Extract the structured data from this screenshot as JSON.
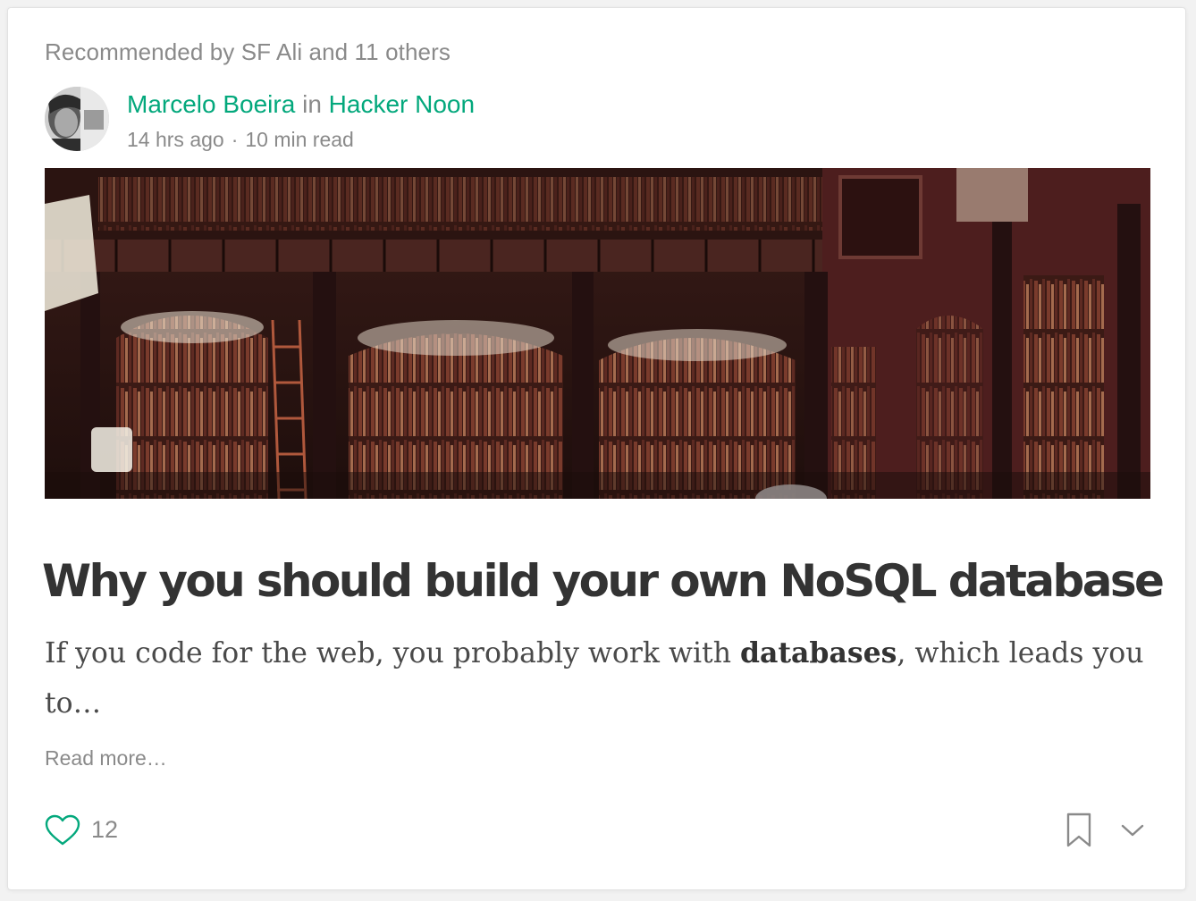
{
  "recommendation": "Recommended by SF Ali and 11 others",
  "author": {
    "name": "Marcelo Boeira",
    "in_word": "in",
    "publication": "Hacker Noon"
  },
  "meta": {
    "time_ago": "14 hrs ago",
    "separator": "·",
    "read_time": "10 min read"
  },
  "hero_image": {
    "subject": "library-interior",
    "palette": [
      "#2a1512",
      "#5a2a24",
      "#8c5a44",
      "#e8dcc8"
    ]
  },
  "post": {
    "title": "Why you should build your own NoSQL database",
    "subtitle_before": "If you code for the web, you probably work with ",
    "subtitle_bold": "databases",
    "subtitle_after": ", which leads you to…",
    "read_more": "Read more…"
  },
  "actions": {
    "clap_count": "12",
    "heart_icon": "heart-icon",
    "bookmark_icon": "bookmark-icon",
    "more_icon": "chevron-down-icon"
  },
  "colors": {
    "accent": "#03a87c",
    "muted": "#8a8a8a",
    "text": "#333333"
  }
}
